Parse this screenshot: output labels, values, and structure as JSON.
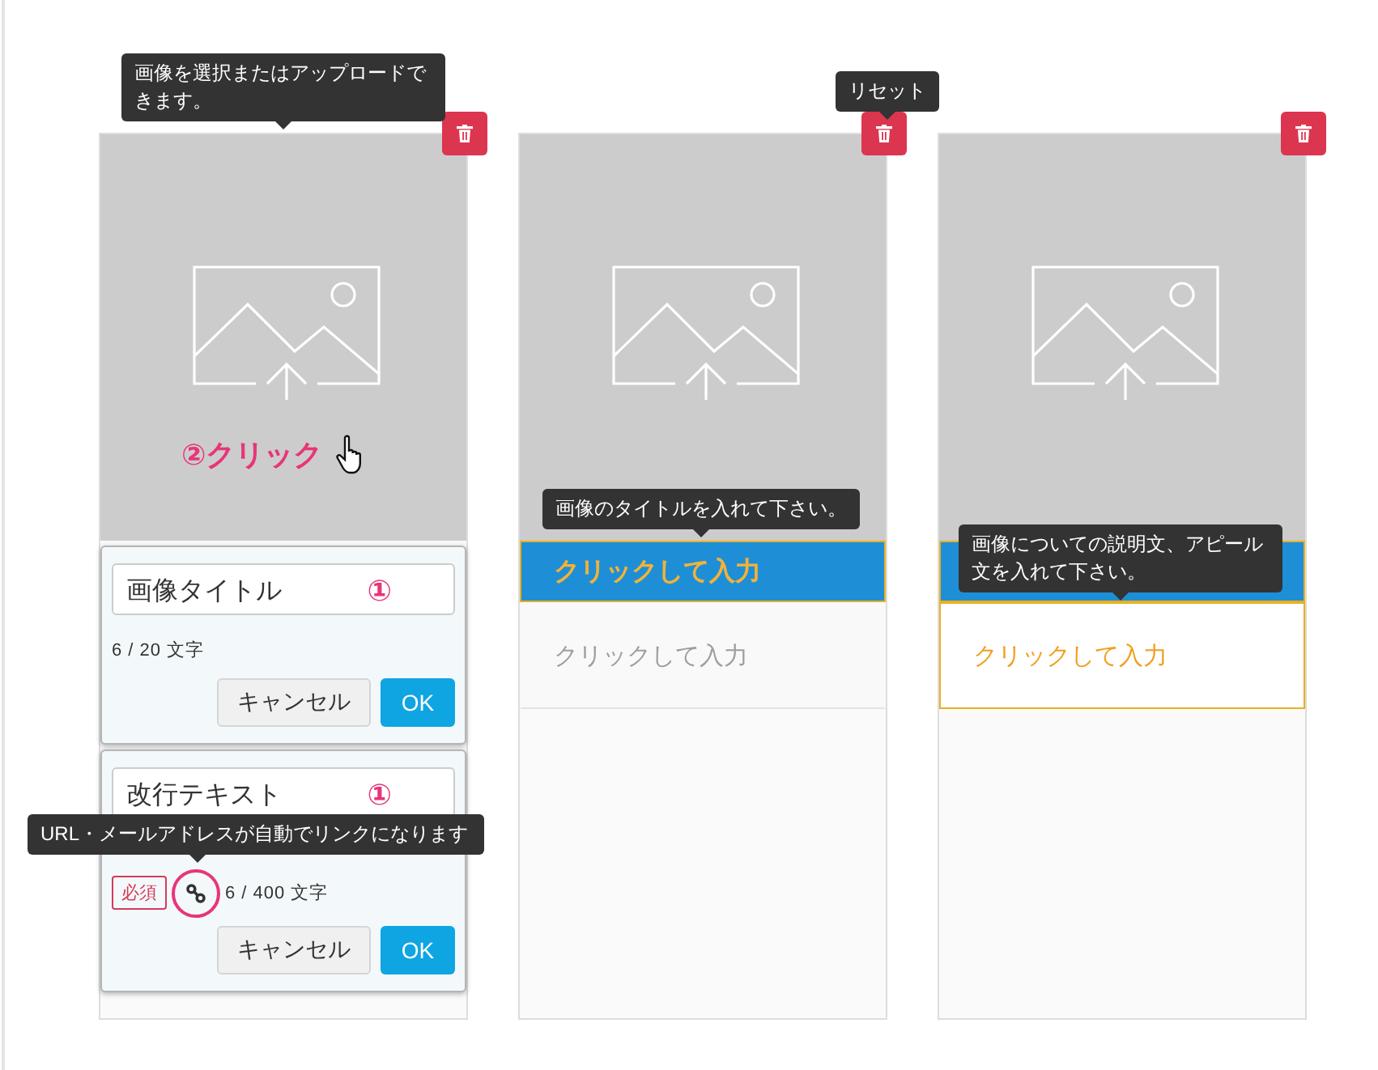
{
  "cards": [
    {
      "image_tooltip": "画像を選択またはアップロードできます。",
      "click_annotation": "②クリック",
      "editors": [
        {
          "kind": "title",
          "value": "画像タイトル",
          "marker": "①",
          "counter": "6 / 20 文字",
          "cancel": "キャンセル",
          "ok": "OK"
        },
        {
          "kind": "text",
          "value": "改行テキスト",
          "marker": "①",
          "required": "必須",
          "link_tooltip": "URL・メールアドレスが自動でリンクになります",
          "counter": "6 / 400 文字",
          "cancel": "キャンセル",
          "ok": "OK"
        }
      ]
    },
    {
      "delete_tooltip": "リセット",
      "title": {
        "text": "クリックして入力",
        "focused": true,
        "tooltip": "画像のタイトルを入れて下さい。"
      },
      "description": {
        "text": "クリックして入力",
        "focused": false
      }
    },
    {
      "title": {
        "focused": true
      },
      "description": {
        "text": "クリックして入力",
        "focused": true,
        "tooltip": "画像についての説明文、アピール文を入れて下さい。"
      }
    }
  ]
}
